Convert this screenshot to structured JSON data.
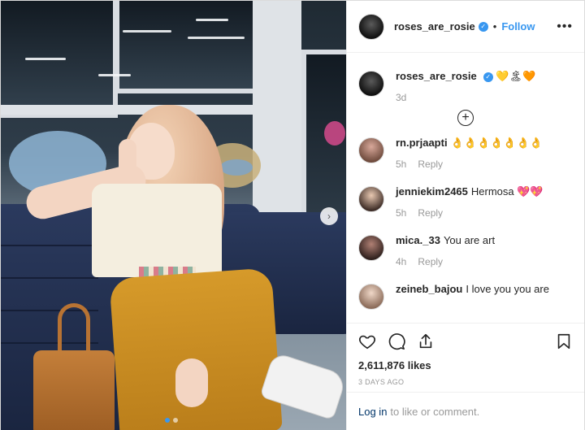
{
  "post": {
    "author": "roses_are_rosie",
    "follow_label": "Follow",
    "more_glyph": "•••",
    "caption_emojis": "💛🏝🧡",
    "caption_time": "3d",
    "load_more_glyph": "+"
  },
  "comments": [
    {
      "user": "rn.prjaapti",
      "text": "👌👌👌👌👌👌👌",
      "time": "5h",
      "reply": "Reply"
    },
    {
      "user": "jenniekim2465",
      "text": "Hermosa 💖💖",
      "time": "5h",
      "reply": "Reply"
    },
    {
      "user": "mica._33",
      "text": "You are art",
      "time": "4h",
      "reply": "Reply"
    },
    {
      "user": "zeineb_bajou",
      "text": "I love you you are",
      "time": "",
      "reply": ""
    }
  ],
  "actions": {
    "likes": "2,611,876 likes",
    "posted": "3 DAYS AGO"
  },
  "login": {
    "link": "Log in",
    "rest": "to like or comment."
  },
  "media": {
    "next_glyph": "›"
  },
  "icons": {
    "heart": "heart-icon",
    "comment": "comment-icon",
    "share": "share-icon",
    "bookmark": "bookmark-icon",
    "verified": "verified-badge-icon"
  }
}
